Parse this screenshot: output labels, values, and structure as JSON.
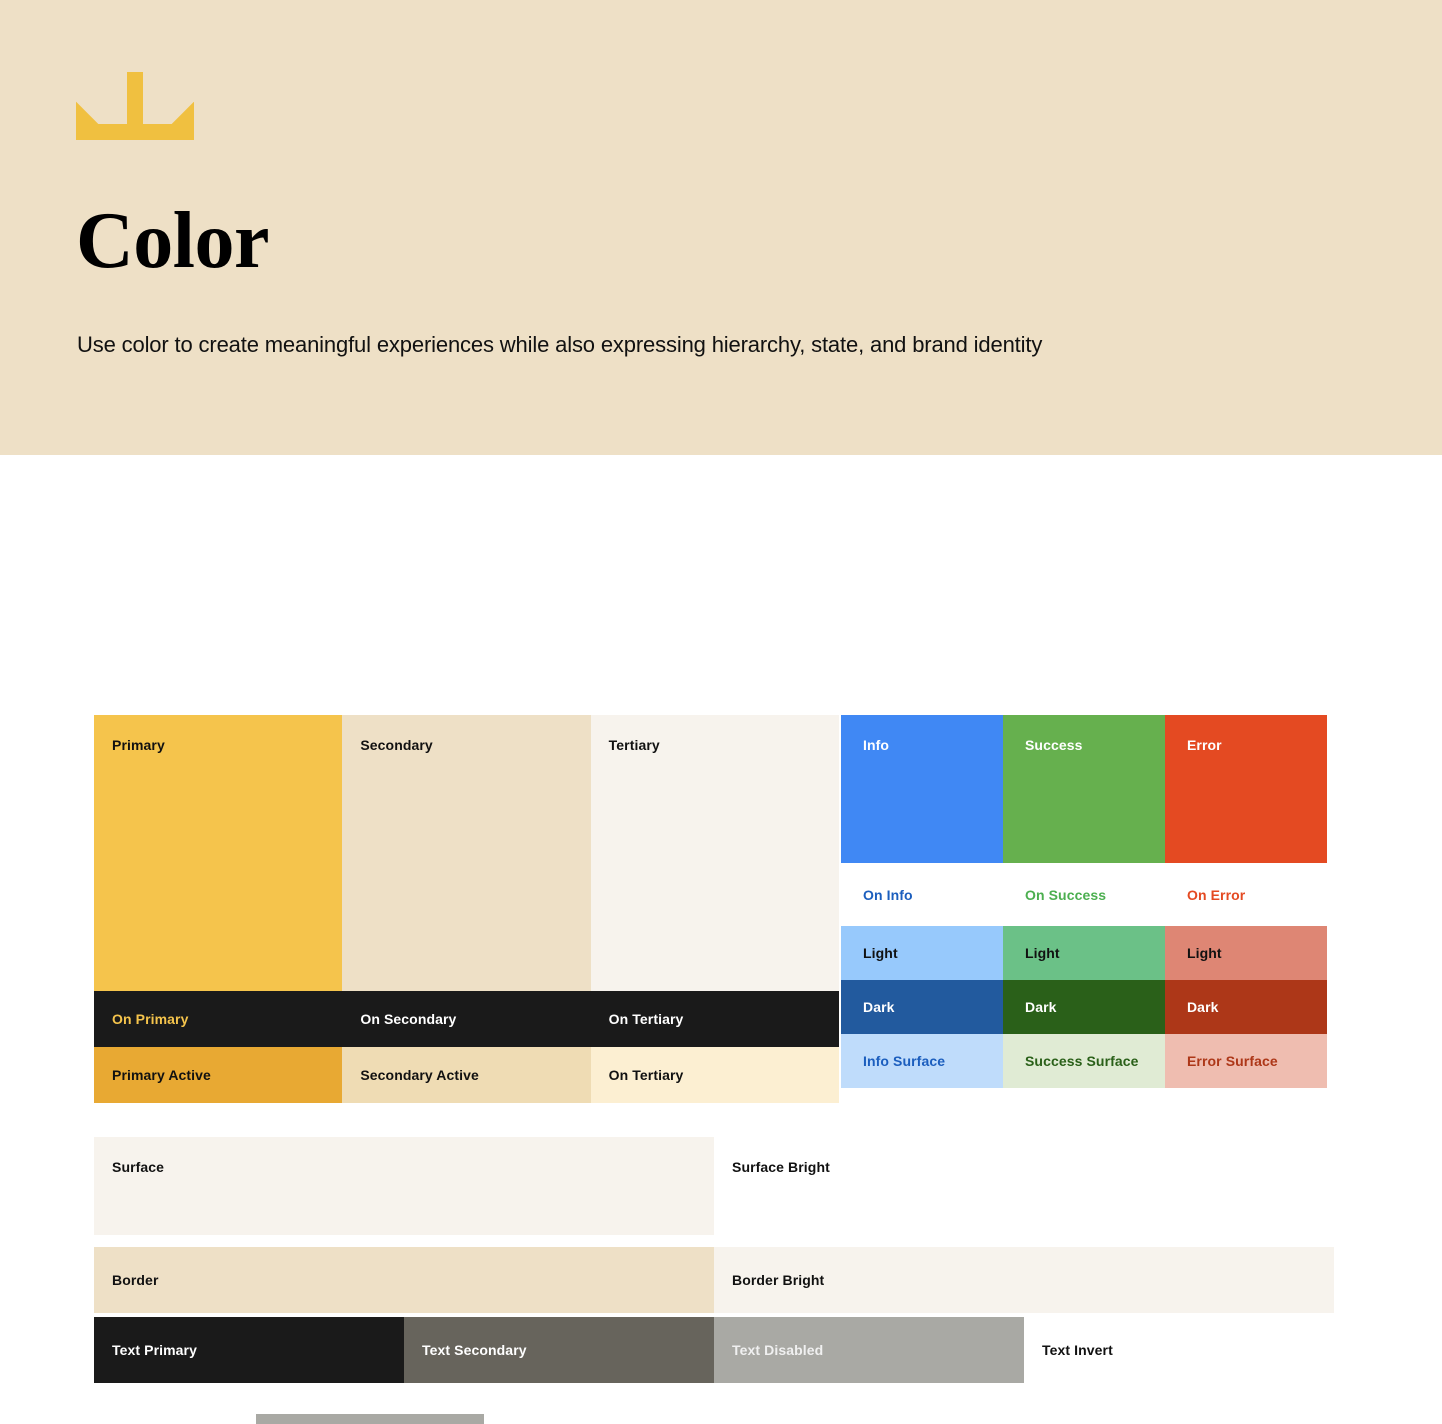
{
  "hero": {
    "logo_icon": "sunburst-logo-icon",
    "title": "Color",
    "subtitle": "Use color to create meaningful experiences while also expressing hierarchy, state, and brand identity",
    "background": "#EEE0C6"
  },
  "brand": {
    "base": [
      {
        "label": "Primary",
        "color": "#F5C44C"
      },
      {
        "label": "Secondary",
        "color": "#EEE0C6"
      },
      {
        "label": "Tertiary",
        "color": "#F7F3ED"
      }
    ],
    "on": [
      {
        "label": "On Primary",
        "color": "#1A1A1A",
        "text_color": "#F5C44C"
      },
      {
        "label": "On Secondary",
        "color": "#1A1A1A",
        "text_color": "#FFFFFF"
      },
      {
        "label": "On Tertiary",
        "color": "#1A1A1A",
        "text_color": "#FFFFFF"
      }
    ],
    "active": [
      {
        "label": "Primary Active",
        "color": "#E8A933",
        "text_color": "#111111"
      },
      {
        "label": "Secondary Active",
        "color": "#EFDCB4",
        "text_color": "#111111"
      },
      {
        "label": "On Tertiary",
        "color": "#FCEFD2",
        "text_color": "#111111"
      }
    ]
  },
  "semantic": {
    "base": [
      {
        "label": "Info",
        "color": "#4088F4"
      },
      {
        "label": "Success",
        "color": "#66B04E"
      },
      {
        "label": "Error",
        "color": "#E44A22"
      }
    ],
    "on": [
      {
        "label": "On Info",
        "text_color": "#1B5EBE"
      },
      {
        "label": "On Success",
        "text_color": "#4CAF50"
      },
      {
        "label": "On Error",
        "text_color": "#E44A22"
      }
    ],
    "light": [
      {
        "label": "Light",
        "color": "#97C9FC",
        "text_color": "#111111"
      },
      {
        "label": "Light",
        "color": "#6BC187",
        "text_color": "#111111"
      },
      {
        "label": "Light",
        "color": "#DE8674",
        "text_color": "#111111"
      }
    ],
    "dark": [
      {
        "label": "Dark",
        "color": "#225A9E",
        "text_color": "#FFFFFF"
      },
      {
        "label": "Dark",
        "color": "#2A6019",
        "text_color": "#FFFFFF"
      },
      {
        "label": "Dark",
        "color": "#AD3718",
        "text_color": "#FFFFFF"
      }
    ],
    "surface": [
      {
        "label": "Info Surface",
        "color": "#BFDCFB",
        "text_color": "#1B5EBE"
      },
      {
        "label": "Success Surface",
        "color": "#E0EBD4",
        "text_color": "#2A6019"
      },
      {
        "label": "Error Surface",
        "color": "#EFBDB0",
        "text_color": "#AD3718"
      }
    ]
  },
  "surfaces": [
    {
      "label": "Surface",
      "color": "#F7F3ED",
      "text_color": "#111111",
      "width_pct": 50
    },
    {
      "label": "Surface Bright",
      "color": "#FFFFFF",
      "text_color": "#111111",
      "width_pct": 50
    }
  ],
  "borders": [
    {
      "label": "Border",
      "color": "#EEE0C6",
      "text_color": "#111111",
      "width_pct": 50
    },
    {
      "label": "Border Bright",
      "color": "#F7F3ED",
      "text_color": "#111111",
      "width_pct": 50
    }
  ],
  "text_colors": [
    {
      "label": "Text Primary",
      "color": "#1A1A1A",
      "text_color": "#FFFFFF",
      "width_pct": 25
    },
    {
      "label": "Text Secondary",
      "color": "#67645C",
      "text_color": "#FFFFFF",
      "width_pct": 25
    },
    {
      "label": "Text Disabled",
      "color": "#A9A9A4",
      "text_color": "#F0F0F0",
      "width_pct": 25
    },
    {
      "label": "Text Invert",
      "color": "#FFFFFF",
      "text_color": "#111111",
      "width_pct": 25
    }
  ],
  "bottom_peek": {
    "color": "#A9A9A4"
  }
}
